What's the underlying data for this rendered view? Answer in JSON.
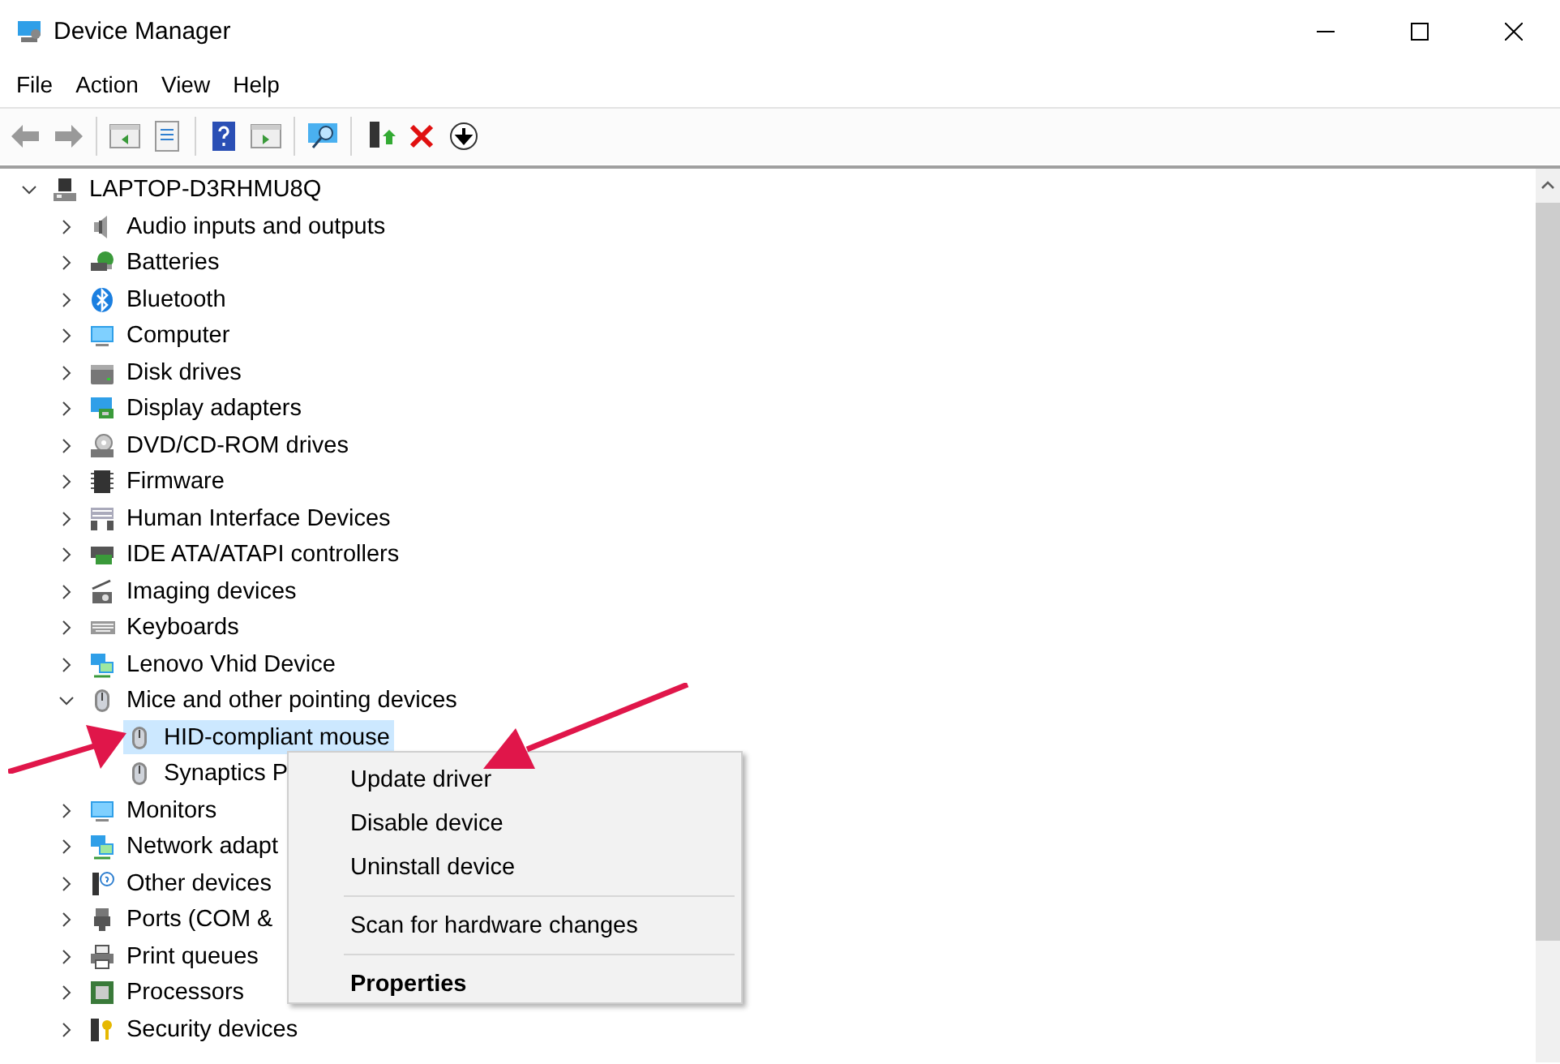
{
  "window": {
    "title": "Device Manager"
  },
  "menu": [
    "File",
    "Action",
    "View",
    "Help"
  ],
  "tree": [
    {
      "label": "LAPTOP-D3RHMU8Q",
      "expanded": true,
      "selected": false,
      "children": [
        {
          "label": "Audio inputs and outputs",
          "expanded": false,
          "selected": false
        },
        {
          "label": "Batteries",
          "expanded": false,
          "selected": false
        },
        {
          "label": "Bluetooth",
          "expanded": false,
          "selected": false
        },
        {
          "label": "Computer",
          "expanded": false,
          "selected": false
        },
        {
          "label": "Disk drives",
          "expanded": false,
          "selected": false
        },
        {
          "label": "Display adapters",
          "expanded": false,
          "selected": false
        },
        {
          "label": "DVD/CD-ROM drives",
          "expanded": false,
          "selected": false
        },
        {
          "label": "Firmware",
          "expanded": false,
          "selected": false
        },
        {
          "label": "Human Interface Devices",
          "expanded": false,
          "selected": false
        },
        {
          "label": "IDE ATA/ATAPI controllers",
          "expanded": false,
          "selected": false
        },
        {
          "label": "Imaging devices",
          "expanded": false,
          "selected": false
        },
        {
          "label": "Keyboards",
          "expanded": false,
          "selected": false
        },
        {
          "label": "Lenovo Vhid Device",
          "expanded": false,
          "selected": false
        },
        {
          "label": "Mice and other pointing devices",
          "expanded": true,
          "selected": false,
          "children": [
            {
              "label": "HID-compliant mouse",
              "selected": true
            },
            {
              "label": "Synaptics P",
              "selected": false
            }
          ]
        },
        {
          "label": "Monitors",
          "expanded": false,
          "selected": false
        },
        {
          "label": "Network adapt",
          "expanded": false,
          "selected": false
        },
        {
          "label": "Other devices",
          "expanded": false,
          "selected": false
        },
        {
          "label": "Ports (COM &",
          "expanded": false,
          "selected": false
        },
        {
          "label": "Print queues",
          "expanded": false,
          "selected": false
        },
        {
          "label": "Processors",
          "expanded": false,
          "selected": false
        },
        {
          "label": "Security devices",
          "expanded": false,
          "selected": false
        }
      ]
    }
  ],
  "context_menu": [
    {
      "kind": "item",
      "label": "Update driver"
    },
    {
      "kind": "item",
      "label": "Disable device"
    },
    {
      "kind": "item",
      "label": "Uninstall device"
    },
    {
      "kind": "separator"
    },
    {
      "kind": "item",
      "label": "Scan for hardware changes"
    },
    {
      "kind": "separator"
    },
    {
      "kind": "default",
      "label": "Properties"
    }
  ]
}
